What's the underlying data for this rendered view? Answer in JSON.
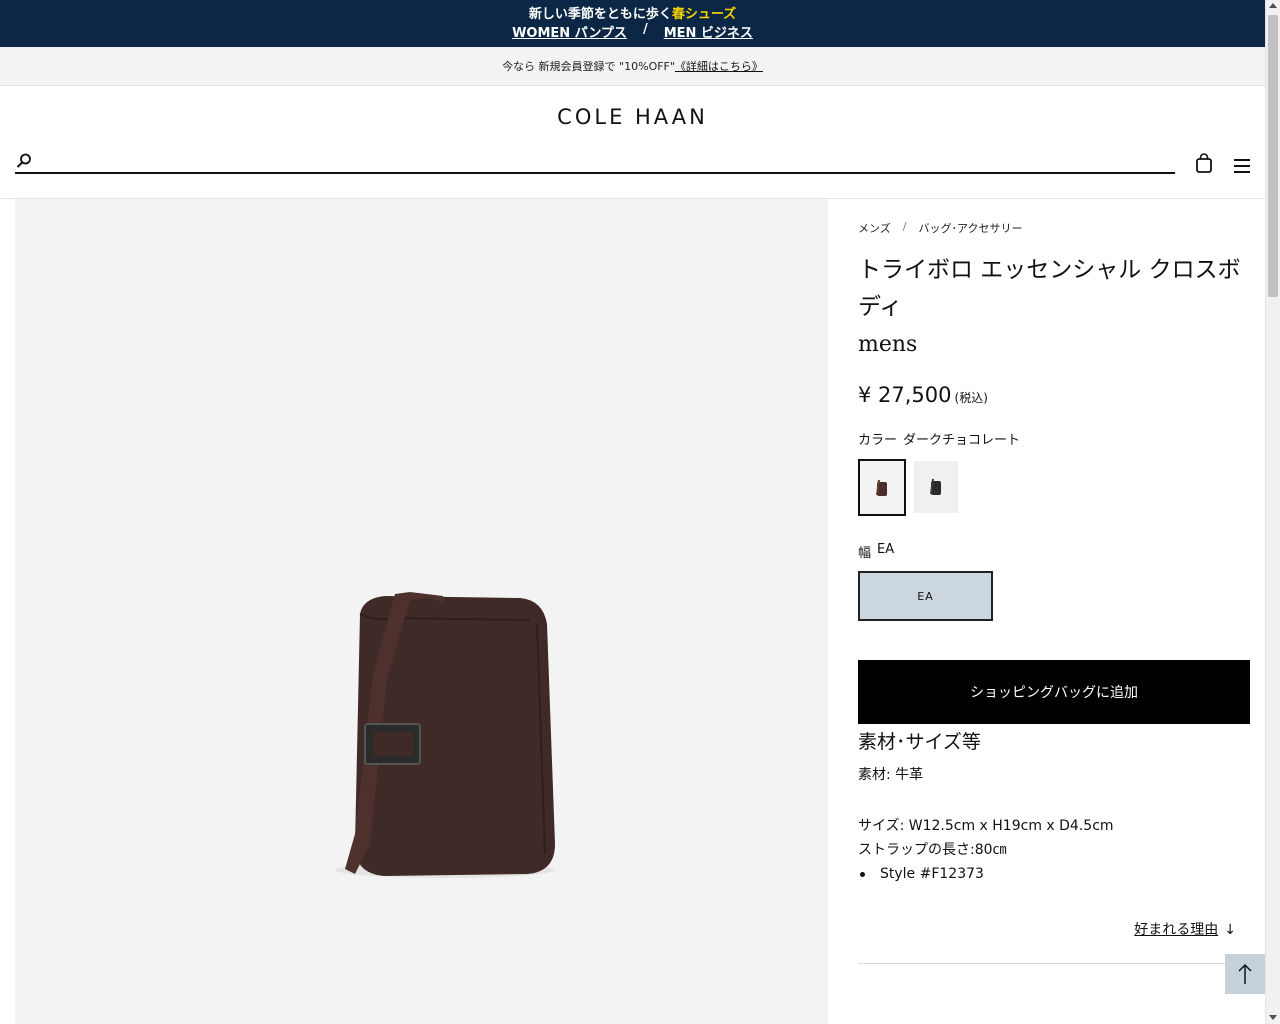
{
  "promo": {
    "line1_prefix": "新しい季節をともに歩く",
    "line1_highlight": "春シューズ",
    "women_link": "WOMEN パンプス",
    "separator": "/",
    "men_link": "MEN ビジネス",
    "highlight_color": "#f6d500",
    "background_color": "#0b2745"
  },
  "announce": {
    "text": "今なら 新規会員登録で \"10%OFF\"",
    "link": "《詳細はこちら》"
  },
  "header": {
    "logo": "COLE HAAN",
    "search_placeholder": ""
  },
  "breadcrumb": {
    "items": [
      "メンズ",
      "バッグ･アクセサリー"
    ],
    "separator": "/"
  },
  "product": {
    "title": "トライボロ エッセンシャル クロスボディ",
    "subtitle": "mens",
    "price": "¥ 27,500",
    "tax_note": "(税込)",
    "color_label": "カラー",
    "color_value": "ダークチョコレート",
    "width_label": "幅",
    "width_value": "EA",
    "width_option": "EA",
    "add_to_bag": "ショッピングバッグに追加",
    "spec_heading": "素材･サイズ等",
    "material": "素材: 牛革",
    "size": "サイズ: W12.5cm x H19cm x D4.5cm",
    "strap": "ストラップの長さ:80㎝",
    "style": "Style #F12373",
    "why_link": "好まれる理由",
    "swatch_colors": [
      "#4a2e2a",
      "#2a2a2a"
    ]
  },
  "icons": {
    "search": "search-icon",
    "bag": "shopping-bag-icon",
    "menu": "hamburger-menu-icon",
    "back_to_top": "arrow-up-icon"
  }
}
